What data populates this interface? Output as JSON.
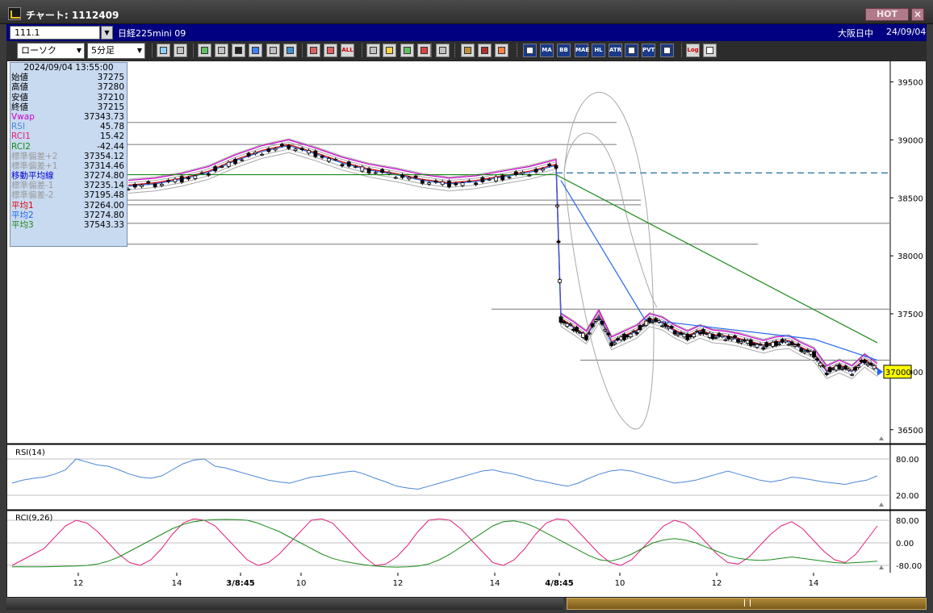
{
  "window": {
    "title": "チャート: 1112409",
    "hot_label": "HOT",
    "close_label": "✕"
  },
  "infobar": {
    "symbol_code": "111.1",
    "instrument": "日経225mini 09",
    "session_status": "大阪日中",
    "date": "24/09/04"
  },
  "toolbar": {
    "chart_type": "ローソク",
    "timeframe": "5分足",
    "icons": [
      "search-icon",
      "crosshair-icon",
      "draw-line-icon",
      "draw-arrow-icon",
      "cursor-icon",
      "flag-icon",
      "notes-icon",
      "delete-icon",
      "candle-toggle-icon",
      "candle-select-icon",
      "all-icon",
      "bookmark-icon",
      "zoom-icon",
      "bar-icon",
      "volume-bar-icon",
      "help-icon",
      "pattern-icon",
      "tools-icon",
      "palette-icon",
      "fib-icon",
      "ma-icon",
      "bb-icon",
      "mae-icon",
      "hl-icon",
      "atr-icon",
      "envelope-icon",
      "pvt-icon",
      "frame-icon",
      "log-icon",
      "export-icon"
    ],
    "icon_labels": {
      "all": "ALL",
      "ma": "MA",
      "bb": "BB",
      "mae": "MAE",
      "hl": "HL",
      "atr": "ATR",
      "pvt": "PVT",
      "log": "Log"
    }
  },
  "ohlc_panel": {
    "datetime": "2024/09/04  13:55:00",
    "rows": [
      {
        "label": "始値",
        "value": "37275",
        "color": "#000000"
      },
      {
        "label": "高値",
        "value": "37280",
        "color": "#000000"
      },
      {
        "label": "安値",
        "value": "37210",
        "color": "#000000"
      },
      {
        "label": "終値",
        "value": "37215",
        "color": "#000000"
      },
      {
        "label": "Vwap",
        "value": "37343.73",
        "color": "#cc00cc"
      },
      {
        "label": "RSI",
        "value": "45.78",
        "color": "#4a86d8"
      },
      {
        "label": "RCI1",
        "value": "15.42",
        "color": "#e0207a"
      },
      {
        "label": "RCI2",
        "value": "-42.44",
        "color": "#1a8a1a"
      },
      {
        "label": "標準偏差+2",
        "value": "37354.12",
        "color": "#9a9a9a"
      },
      {
        "label": "標準偏差+1",
        "value": "37314.46",
        "color": "#9a9a9a"
      },
      {
        "label": "移動平均線",
        "value": "37274.80",
        "color": "#0000cc"
      },
      {
        "label": "標準偏差-1",
        "value": "37235.14",
        "color": "#9a9a9a"
      },
      {
        "label": "標準偏差-2",
        "value": "37195.48",
        "color": "#9a9a9a"
      },
      {
        "label": "平均1",
        "value": "37264.00",
        "color": "#e00000"
      },
      {
        "label": "平均2",
        "value": "37274.80",
        "color": "#2266ee"
      },
      {
        "label": "平均3",
        "value": "37543.33",
        "color": "#1a8a1a"
      }
    ]
  },
  "colors": {
    "candle_up": "#ffffff",
    "candle_down": "#000000",
    "ma1": "#e00000",
    "ma2": "#2266ee",
    "ma3": "#1a8a1a",
    "vwap": "#cc00cc",
    "bands": "#a8a8a8",
    "rsi": "#4a86d8",
    "rci1": "#e0207a",
    "rci2": "#1a8a1a",
    "current_tag": "#ffff00"
  },
  "chart_data": [
    {
      "type": "candlestick",
      "ylim": [
        36380,
        39650
      ],
      "y_ticks": [
        {
          "value": 39500,
          "label": "39500"
        },
        {
          "value": 39000,
          "label": "39000"
        },
        {
          "value": 38500,
          "label": "38500"
        },
        {
          "value": 38000,
          "label": "38000"
        },
        {
          "value": 37500,
          "label": "37500"
        },
        {
          "value": 37000,
          "label": "37000"
        },
        {
          "value": 36500,
          "label": "36500"
        }
      ],
      "x_ticks": [
        "12",
        "14",
        "3/8:45",
        "10",
        "12",
        "14",
        "4/8:45",
        "10",
        "12",
        "14"
      ],
      "current_price_label": "37000",
      "dashed_reference": 38715,
      "horizontal_levels": [
        39150,
        38960,
        38480,
        38440,
        38280,
        38100,
        37540,
        37100
      ],
      "close_path": [
        38600,
        38620,
        38660,
        38720,
        38820,
        38900,
        38950,
        38880,
        38800,
        38740,
        38700,
        38650,
        38620,
        38640,
        38680,
        38720,
        38780,
        37450,
        37380,
        37300,
        37480,
        37250,
        37300,
        37350,
        37450,
        37420,
        37350,
        37300,
        37350,
        37310,
        37300,
        37280,
        37250,
        37220,
        37250,
        37260,
        37200,
        37150,
        37000,
        37050,
        37000,
        37100,
        37020
      ]
    },
    {
      "type": "line",
      "title": "RSI(14)",
      "ylim": [
        0,
        100
      ],
      "y_ticks": [
        80,
        20
      ],
      "y_tick_labels": [
        "80.00",
        "20.00"
      ],
      "series": [
        {
          "name": "RSI",
          "values": [
            40,
            45,
            48,
            50,
            55,
            62,
            80,
            75,
            70,
            68,
            62,
            55,
            50,
            48,
            52,
            62,
            72,
            78,
            80,
            68,
            65,
            60,
            55,
            50,
            45,
            42,
            40,
            45,
            50,
            52,
            55,
            58,
            60,
            55,
            48,
            42,
            35,
            32,
            30,
            35,
            40,
            45,
            50,
            55,
            60,
            62,
            58,
            55,
            50,
            45,
            42,
            38,
            35,
            40,
            48,
            55,
            60,
            62,
            60,
            55,
            50,
            45,
            40,
            42,
            45,
            50,
            55,
            60,
            55,
            50,
            45,
            42,
            45,
            50,
            48,
            45,
            42,
            40,
            38,
            42,
            45,
            52
          ]
        }
      ]
    },
    {
      "type": "line",
      "title": "RCI(9,26)",
      "ylim": [
        -100,
        100
      ],
      "y_ticks": [
        80,
        0,
        -80
      ],
      "y_tick_labels": [
        "80.00",
        "0.00",
        "-80.00"
      ],
      "series": [
        {
          "name": "RCI1",
          "values": [
            -80,
            -60,
            -40,
            -20,
            20,
            60,
            80,
            70,
            40,
            0,
            -40,
            -70,
            -80,
            -60,
            -20,
            30,
            70,
            85,
            80,
            60,
            20,
            -20,
            -60,
            -80,
            -70,
            -40,
            0,
            40,
            80,
            85,
            70,
            30,
            -10,
            -50,
            -80,
            -75,
            -50,
            -10,
            40,
            80,
            85,
            80,
            50,
            10,
            -30,
            -70,
            -80,
            -60,
            -20,
            30,
            70,
            85,
            80,
            40,
            0,
            -40,
            -70,
            -80,
            -60,
            -20,
            20,
            60,
            80,
            70,
            40,
            0,
            -40,
            -70,
            -75,
            -50,
            -10,
            30,
            60,
            75,
            50,
            10,
            -30,
            -60,
            -70,
            -40,
            10,
            60
          ]
        },
        {
          "name": "RCI2",
          "values": [
            -85,
            -85,
            -85,
            -85,
            -84,
            -83,
            -82,
            -80,
            -75,
            -65,
            -50,
            -30,
            -10,
            10,
            30,
            50,
            65,
            75,
            80,
            82,
            83,
            82,
            80,
            70,
            55,
            40,
            20,
            0,
            -20,
            -40,
            -55,
            -65,
            -72,
            -78,
            -82,
            -85,
            -86,
            -85,
            -82,
            -75,
            -60,
            -40,
            -15,
            10,
            35,
            60,
            75,
            78,
            70,
            55,
            35,
            15,
            -5,
            -25,
            -45,
            -60,
            -65,
            -55,
            -40,
            -20,
            0,
            10,
            15,
            10,
            0,
            -15,
            -30,
            -45,
            -55,
            -60,
            -62,
            -60,
            -55,
            -50,
            -55,
            -60,
            -65,
            -70,
            -72,
            -70,
            -68,
            -65
          ]
        }
      ]
    }
  ]
}
